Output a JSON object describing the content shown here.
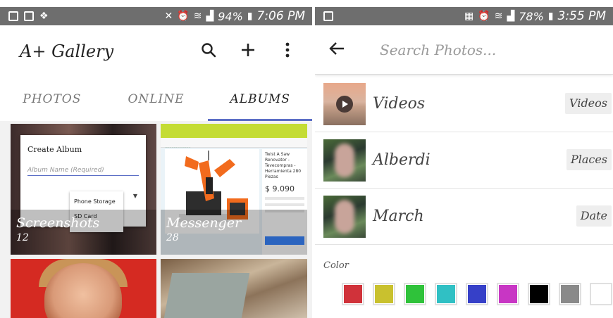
{
  "left": {
    "status": {
      "battery_pct": "94%",
      "time": "7:06 PM"
    },
    "app_title": "A+ Gallery",
    "tabs": [
      {
        "label": "PHOTOS",
        "active": false
      },
      {
        "label": "ONLINE",
        "active": false
      },
      {
        "label": "ALBUMS",
        "active": true
      }
    ],
    "tiles": [
      {
        "name": "Screenshots",
        "count": "12"
      },
      {
        "name": "Messenger",
        "count": "28"
      }
    ],
    "dialog": {
      "title": "Create Album",
      "placeholder": "Album Name (Required)",
      "menu": [
        "Phone Storage",
        "SD Card"
      ]
    },
    "web": {
      "product_title": "Twist A Saw Renovator - Tevecompras - Herramienta 280 Piezas",
      "price": "$ 9.090"
    }
  },
  "right": {
    "status": {
      "battery_pct": "78%",
      "time": "3:55 PM"
    },
    "search": {
      "placeholder": "Search Photos..."
    },
    "rows": [
      {
        "label": "Videos",
        "tag": "Videos"
      },
      {
        "label": "Alberdi",
        "tag": "Places"
      },
      {
        "label": "March",
        "tag": "Date"
      }
    ],
    "color_label": "Color",
    "colors": [
      "#d0323a",
      "#c9c12e",
      "#2fc23a",
      "#30c0c4",
      "#3640c8",
      "#c836c4",
      "#000000",
      "#8a8a8a",
      "#ffffff"
    ]
  }
}
